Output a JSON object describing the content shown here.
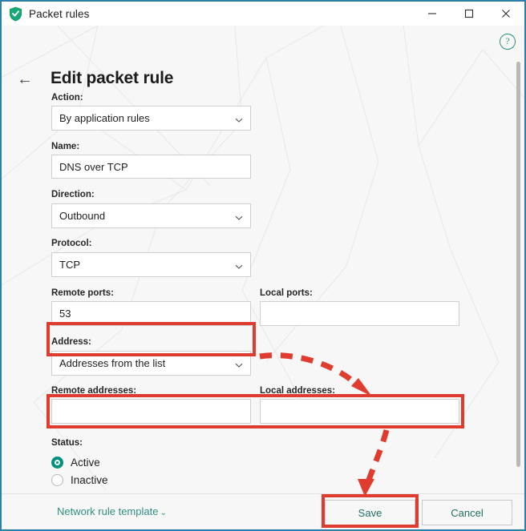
{
  "window": {
    "title": "Packet rules",
    "app_icon": "green-shield-check-icon",
    "minimize": "–",
    "maximize": "□",
    "close": "✕"
  },
  "header": {
    "back_icon": "back-arrow-icon",
    "page_title": "Edit packet rule",
    "help_icon": "?"
  },
  "form": {
    "action": {
      "label": "Action:",
      "value": "By application rules",
      "type": "dropdown"
    },
    "name": {
      "label": "Name:",
      "value": "DNS over TCP",
      "type": "text"
    },
    "direction": {
      "label": "Direction:",
      "value": "Outbound",
      "type": "dropdown"
    },
    "protocol": {
      "label": "Protocol:",
      "value": "TCP",
      "type": "dropdown"
    },
    "remote_ports": {
      "label": "Remote ports:",
      "value": "53",
      "type": "text"
    },
    "local_ports": {
      "label": "Local ports:",
      "value": "",
      "type": "text"
    },
    "address": {
      "label": "Address:",
      "value": "Addresses from the list",
      "type": "dropdown"
    },
    "remote_addresses": {
      "label": "Remote addresses:",
      "value": "",
      "type": "text"
    },
    "local_addresses": {
      "label": "Local addresses:",
      "value": "",
      "type": "text"
    },
    "status": {
      "label": "Status:",
      "options": [
        {
          "label": "Active",
          "selected": true
        },
        {
          "label": "Inactive",
          "selected": false
        }
      ]
    }
  },
  "footer": {
    "template_link": "Network rule template",
    "template_chevron": "⌄",
    "save_label": "Save",
    "cancel_label": "Cancel"
  },
  "annotations": {
    "color": "#e03b2f",
    "highlighted": [
      "address-dropdown",
      "remote-and-local-addresses",
      "save-button"
    ],
    "arrows": 2
  },
  "colors": {
    "window_border": "#2b7fa8",
    "content_bg": "#f7f7f7",
    "accent_teal": "#2e8f80",
    "radio_selected": "#00917e",
    "annotation_red": "#e03b2f"
  }
}
